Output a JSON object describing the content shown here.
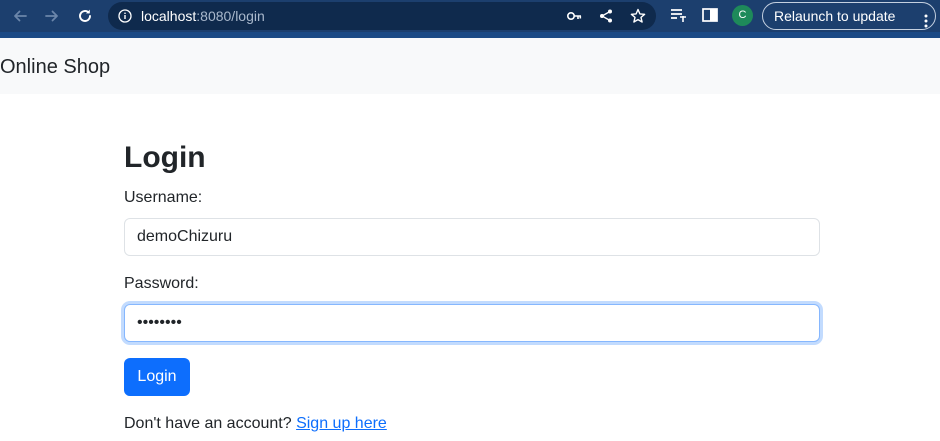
{
  "browser": {
    "url_host": "localhost",
    "url_path": ":8080/login",
    "profile_initial": "C",
    "relaunch_label": "Relaunch to update",
    "icons": [
      "back-arrow-icon",
      "forward-arrow-icon",
      "reload-icon",
      "info-icon",
      "key-icon",
      "share-icon",
      "star-icon",
      "reading-list-icon",
      "side-panel-icon",
      "kebab-menu-icon"
    ]
  },
  "navbar": {
    "brand": "Online Shop"
  },
  "login": {
    "heading": "Login",
    "username_label": "Username:",
    "username_value": "demoChizuru",
    "password_label": "Password:",
    "password_value": "••••••••",
    "submit_label": "Login",
    "signup_prompt": "Don't have an account?",
    "signup_link": "Sign up here"
  },
  "colors": {
    "chrome": "#1c3f6e",
    "omnibox": "#0f2a4d",
    "primary": "#0d6efd",
    "navbar_bg": "#f8f9fa",
    "focus_border": "#86b7fe"
  }
}
